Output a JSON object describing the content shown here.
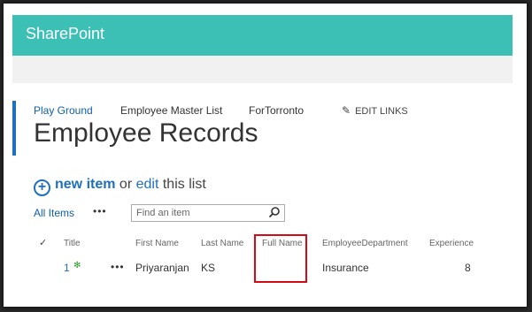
{
  "suite_bar": {
    "brand": "SharePoint"
  },
  "top_nav": {
    "items": [
      {
        "label": "Play Ground"
      },
      {
        "label": "Employee Master List"
      },
      {
        "label": "ForTorronto"
      }
    ],
    "edit_links": "EDIT LINKS"
  },
  "page": {
    "title": "Employee Records"
  },
  "list_actions": {
    "new_item": "new item",
    "or": "or",
    "edit": "edit",
    "this_list": "this list"
  },
  "views": {
    "current": "All Items",
    "more": "•••"
  },
  "search": {
    "placeholder": "Find an item"
  },
  "table": {
    "check_header": "✓",
    "columns": [
      "Title",
      "First Name",
      "Last Name",
      "Full Name",
      "EmployeeDepartment",
      "Experience"
    ],
    "rows": [
      {
        "title": "1",
        "new_marker": "✻",
        "more": "•••",
        "first_name": "Priyaranjan",
        "last_name": "KS",
        "full_name": "",
        "department": "Insurance",
        "experience": "8"
      }
    ]
  },
  "colors": {
    "suite_bar": "#3cbfb5",
    "link": "#1f6fbf",
    "highlight": "#d40b14"
  }
}
